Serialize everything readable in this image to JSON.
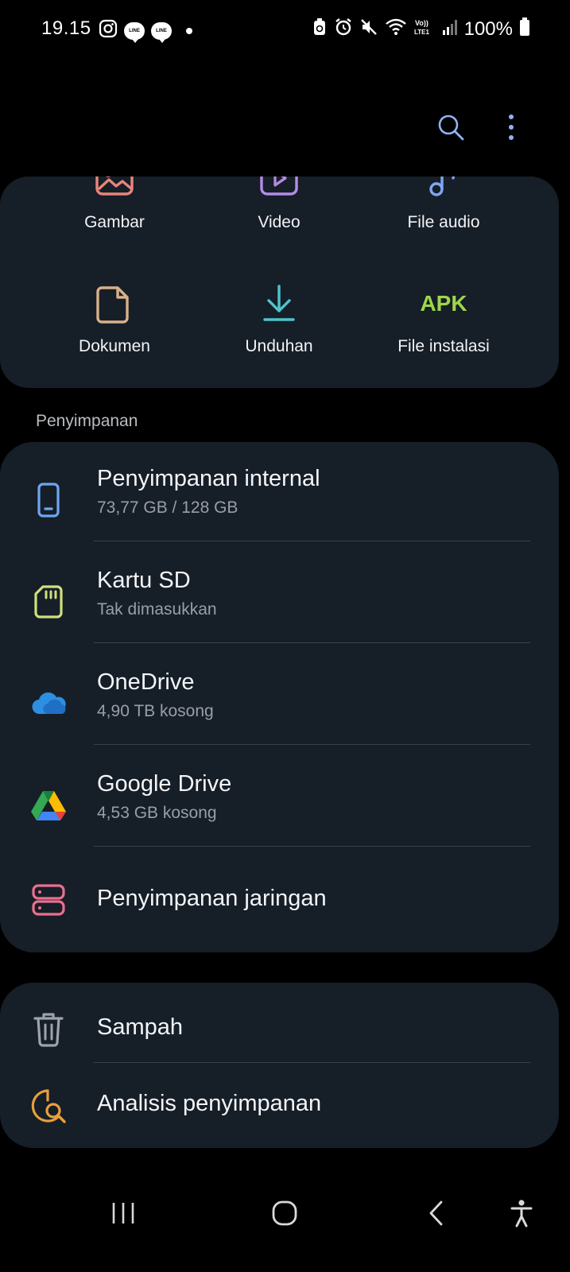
{
  "status_bar": {
    "time": "19.15",
    "battery": "100%",
    "left_icons": [
      "instagram-icon",
      "line-icon",
      "line-icon",
      "dot"
    ],
    "right_icons": [
      "saver-icon",
      "alarm-icon",
      "mute-icon",
      "wifi-icon",
      "volte-icon",
      "signal-icon",
      "battery-icon"
    ]
  },
  "toolbar": {
    "search_icon": "search-icon",
    "more_icon": "more-vertical-icon"
  },
  "categories": [
    {
      "label": "Gambar",
      "icon": "image-icon",
      "color": "#e8857a"
    },
    {
      "label": "Video",
      "icon": "video-icon",
      "color": "#b58ce8"
    },
    {
      "label": "File audio",
      "icon": "music-note-icon",
      "color": "#7ea7f2"
    },
    {
      "label": "Dokumen",
      "icon": "document-icon",
      "color": "#d8b08a"
    },
    {
      "label": "Unduhan",
      "icon": "download-icon",
      "color": "#4fc4cc"
    },
    {
      "label": "File instalasi",
      "icon": "apk-icon",
      "color": "#9ed649",
      "icon_text": "APK"
    }
  ],
  "storage_section": {
    "title": "Penyimpanan",
    "items": [
      {
        "title": "Penyimpanan internal",
        "subtitle": "73,77 GB / 128 GB",
        "icon": "phone-icon",
        "color": "#6ea6f0"
      },
      {
        "title": "Kartu SD",
        "subtitle": "Tak dimasukkan",
        "icon": "sd-card-icon",
        "color": "#cfe07a"
      },
      {
        "title": "OneDrive",
        "subtitle": "4,90 TB kosong",
        "icon": "onedrive-icon",
        "color": "#2d8fe0"
      },
      {
        "title": "Google Drive",
        "subtitle": "4,53 GB kosong",
        "icon": "google-drive-icon",
        "color": "#34a853"
      },
      {
        "title": "Penyimpanan jaringan",
        "subtitle": "",
        "icon": "network-storage-icon",
        "color": "#e8708e"
      }
    ]
  },
  "utilities": {
    "items": [
      {
        "title": "Sampah",
        "icon": "trash-icon",
        "color": "#9ea3ab"
      },
      {
        "title": "Analisis penyimpanan",
        "icon": "storage-analysis-icon",
        "color": "#e8a03a"
      }
    ]
  },
  "nav_bar": {
    "recents_icon": "recents-icon",
    "home_icon": "home-icon",
    "back_icon": "back-icon",
    "accessibility_icon": "accessibility-icon"
  }
}
